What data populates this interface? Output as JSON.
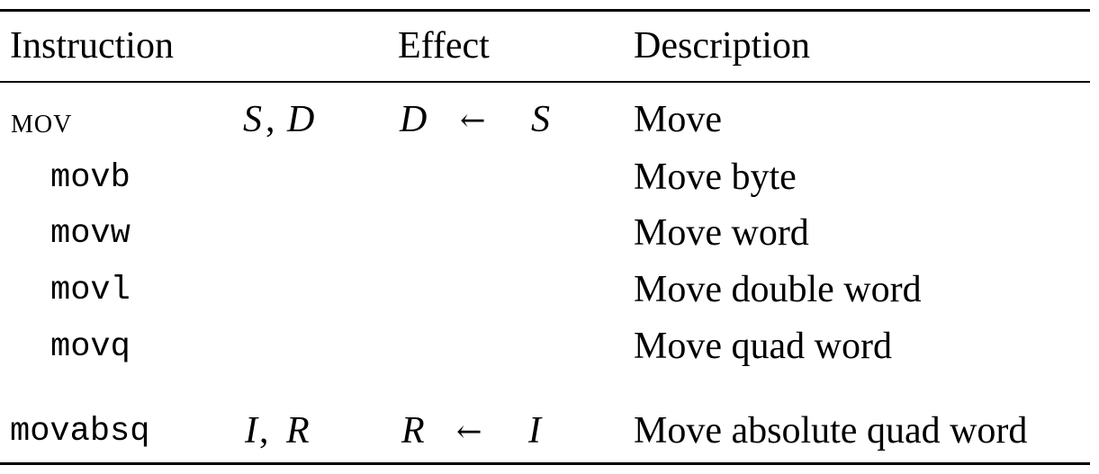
{
  "table": {
    "headers": {
      "instruction": "Instruction",
      "effect": "Effect",
      "description": "Description"
    },
    "rows": [
      {
        "instruction": "mov",
        "operands": {
          "first": "S",
          "sep": ",",
          "second": "D"
        },
        "effect": {
          "dest": "D",
          "arrow": "←",
          "src": "S"
        },
        "description": "Move"
      },
      {
        "instruction": "movb",
        "description": "Move byte"
      },
      {
        "instruction": "movw",
        "description": "Move word"
      },
      {
        "instruction": "movl",
        "description": "Move double word"
      },
      {
        "instruction": "movq",
        "description": "Move quad word"
      },
      {
        "instruction": "movabsq",
        "operands": {
          "first": "I",
          "sep": ",",
          "second": "R"
        },
        "effect": {
          "dest": "R",
          "arrow": "←",
          "src": "I"
        },
        "description": "Move absolute quad word"
      }
    ]
  }
}
